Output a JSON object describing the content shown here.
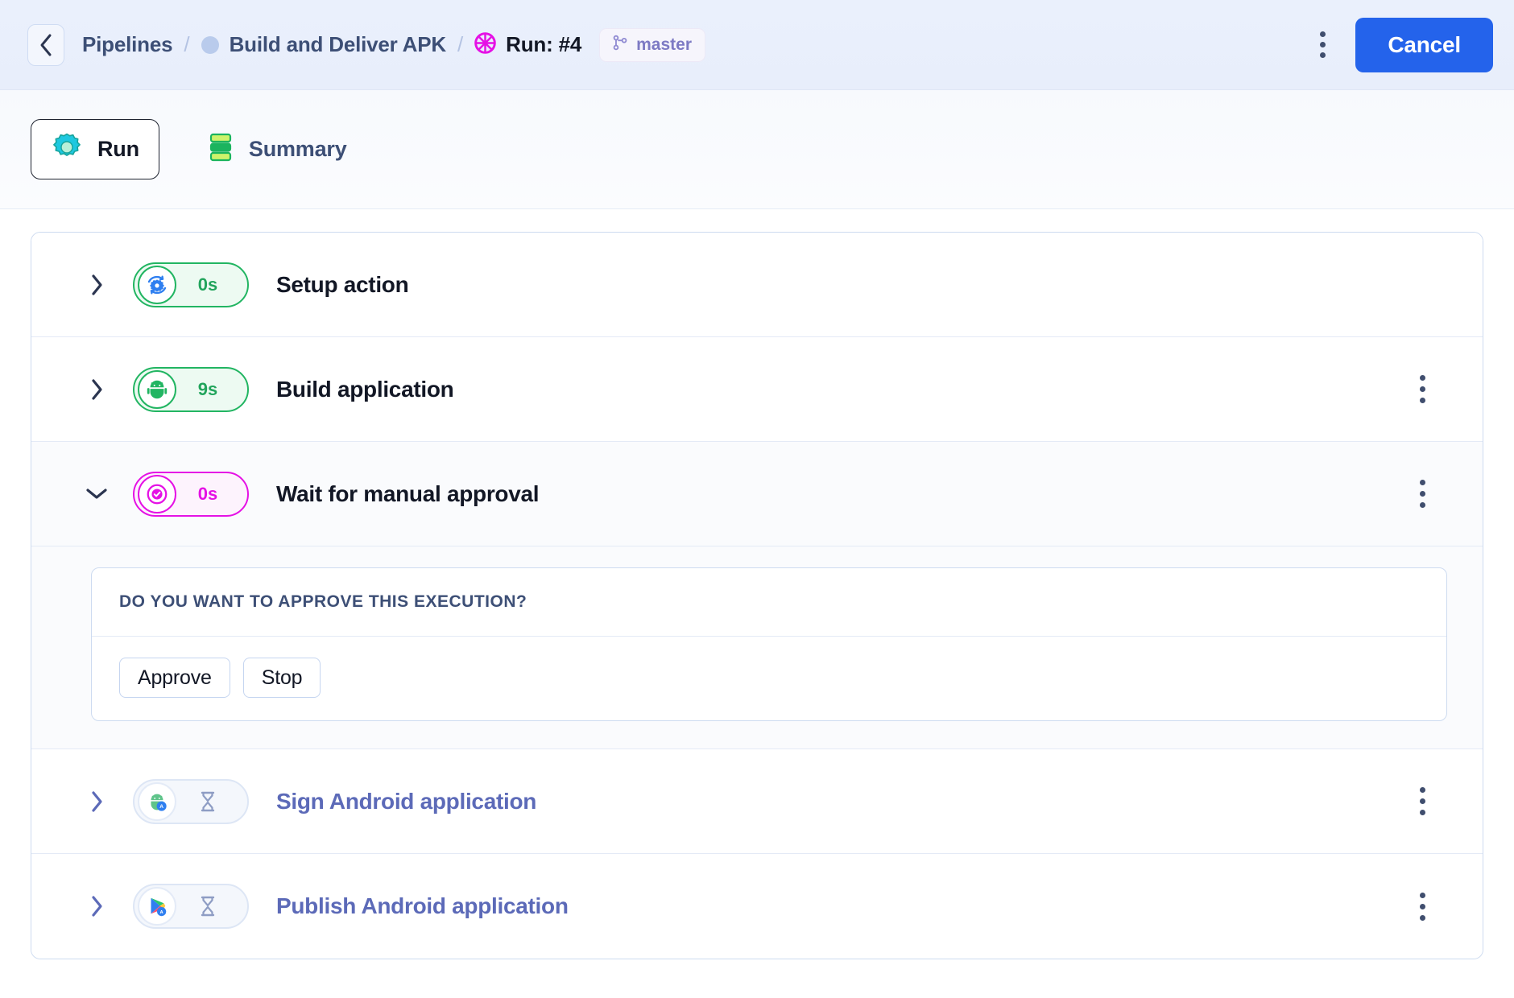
{
  "topbar": {
    "back_icon": "chevron-left-icon",
    "breadcrumb": {
      "pipelines_label": "Pipelines",
      "separator": "/",
      "pipeline_name": "Build and Deliver APK",
      "pipeline_status_icon": "pipeline-status-dot",
      "run_icon": "run-spinner-icon",
      "run_label": "Run: #4"
    },
    "branch": {
      "icon": "git-branch-icon",
      "label": "master"
    },
    "overflow_icon": "kebab-menu-icon",
    "cancel_label": "Cancel",
    "accent_color": "#2463eb"
  },
  "tabs": [
    {
      "label": "Run",
      "icon": "run-gear-icon",
      "active": true
    },
    {
      "label": "Summary",
      "icon": "summary-stack-icon",
      "active": false
    }
  ],
  "steps": [
    {
      "name": "Setup action",
      "duration": "0s",
      "status": "ok",
      "status_color": "#22b562",
      "icon": "setup-gear-sync-icon",
      "chevron": "chevron-right-icon",
      "expanded": false,
      "has_menu": false
    },
    {
      "name": "Build application",
      "duration": "9s",
      "status": "ok",
      "status_color": "#22b562",
      "icon": "android-robot-icon",
      "chevron": "chevron-right-icon",
      "expanded": false,
      "has_menu": true
    },
    {
      "name": "Wait for manual approval",
      "duration": "0s",
      "status": "running",
      "status_color": "#e511e5",
      "icon": "approval-target-icon",
      "chevron": "chevron-down-icon",
      "expanded": true,
      "has_menu": true
    },
    {
      "name": "Sign Android application",
      "duration": "",
      "status": "pending",
      "status_color": "#dde6f5",
      "icon": "android-sign-apk-icon",
      "chevron": "chevron-right-icon",
      "expanded": false,
      "has_menu": true
    },
    {
      "name": "Publish Android application",
      "duration": "",
      "status": "pending",
      "status_color": "#dde6f5",
      "icon": "google-play-icon",
      "chevron": "chevron-right-icon",
      "expanded": false,
      "has_menu": true
    }
  ],
  "approval": {
    "question": "DO YOU WANT TO APPROVE THIS EXECUTION?",
    "approve_label": "Approve",
    "stop_label": "Stop"
  }
}
